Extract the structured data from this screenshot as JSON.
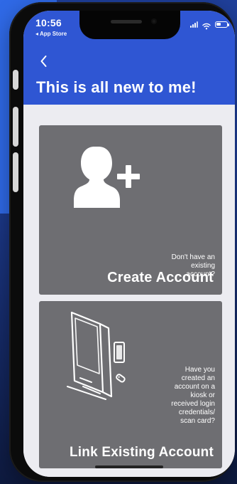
{
  "status_bar": {
    "time": "10:56",
    "back_app": "◂ App Store"
  },
  "header": {
    "back_icon": "chevron-left-icon",
    "title": "This is all new to me!",
    "accent_color": "#2f56d3"
  },
  "cards": [
    {
      "id": "create_account",
      "icon": "person-add-icon",
      "question": "Don't have an\nexisting\naccount?",
      "title": "Create Account",
      "color": "#6e6e72"
    },
    {
      "id": "link_existing_account",
      "icon": "kiosk-card-icon",
      "question": "Have you\ncreated an\naccount on a\nkiosk or\nreceived login\ncredentials/\nscan card?",
      "title": "Link Existing Account",
      "color": "#6e6e72"
    }
  ]
}
